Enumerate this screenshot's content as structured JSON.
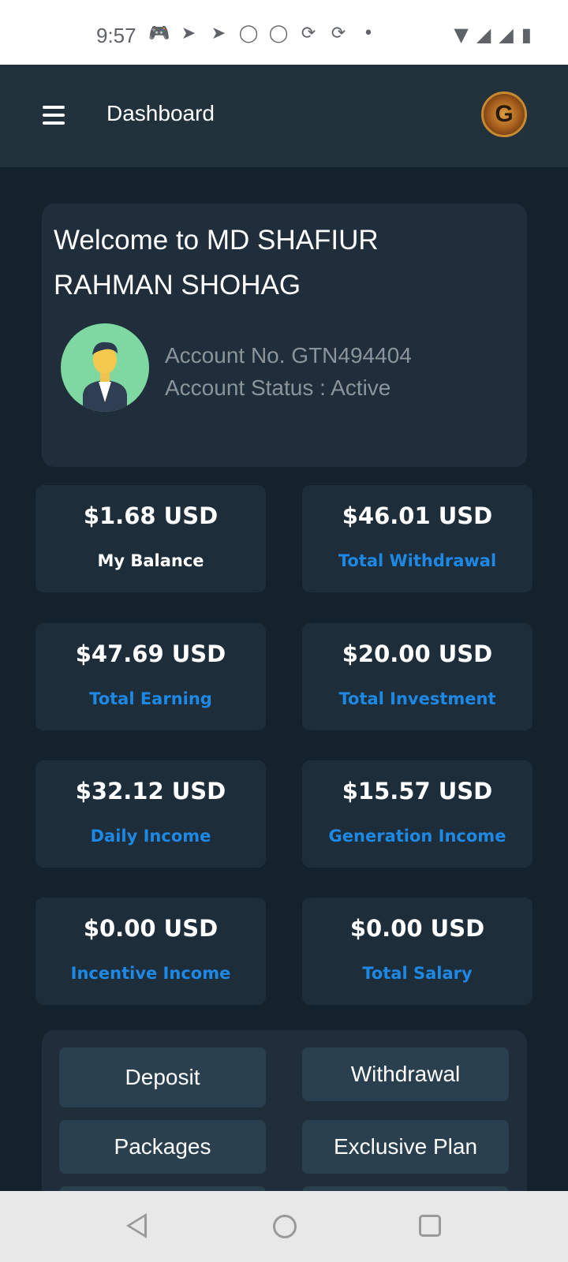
{
  "status_bar": {
    "time": "9:57",
    "icons": [
      "game-icon",
      "telegram-icon",
      "telegram-icon",
      "whatsapp-icon",
      "messenger-icon",
      "share-icon",
      "share-icon",
      "dot-icon"
    ],
    "right_icons": [
      "wifi-icon",
      "signal-icon",
      "signal-icon",
      "battery-icon"
    ]
  },
  "app_bar": {
    "title": "Dashboard",
    "logo_letter": "G"
  },
  "welcome": {
    "title": "Welcome to MD SHAFIUR RAHMAN SHOHAG",
    "account_no": "Account No. GTN494404",
    "account_status": "Account Status : Active"
  },
  "stats": [
    {
      "value": "$1.68 USD",
      "label": "My Balance",
      "label_color": "#ffffff"
    },
    {
      "value": "$46.01 USD",
      "label": "Total Withdrawal",
      "label_color": "#1e88e5"
    },
    {
      "value": "$47.69 USD",
      "label": "Total Earning",
      "label_color": "#1e88e5"
    },
    {
      "value": "$20.00 USD",
      "label": "Total Investment",
      "label_color": "#1e88e5"
    },
    {
      "value": "$32.12 USD",
      "label": "Daily Income",
      "label_color": "#1e88e5"
    },
    {
      "value": "$15.57 USD",
      "label": "Generation Income",
      "label_color": "#1e88e5"
    },
    {
      "value": "$0.00 USD",
      "label": "Incentive Income",
      "label_color": "#1e88e5"
    },
    {
      "value": "$0.00 USD",
      "label": "Total Salary",
      "label_color": "#1e88e5"
    }
  ],
  "actions": {
    "deposit": "Deposit",
    "withdrawal": "Withdrawal",
    "packages": "Packages",
    "exclusive_plan": "Exclusive Plan"
  },
  "colors": {
    "background": "#14222d",
    "card": "#1d2d39",
    "accent": "#1e88e5"
  }
}
